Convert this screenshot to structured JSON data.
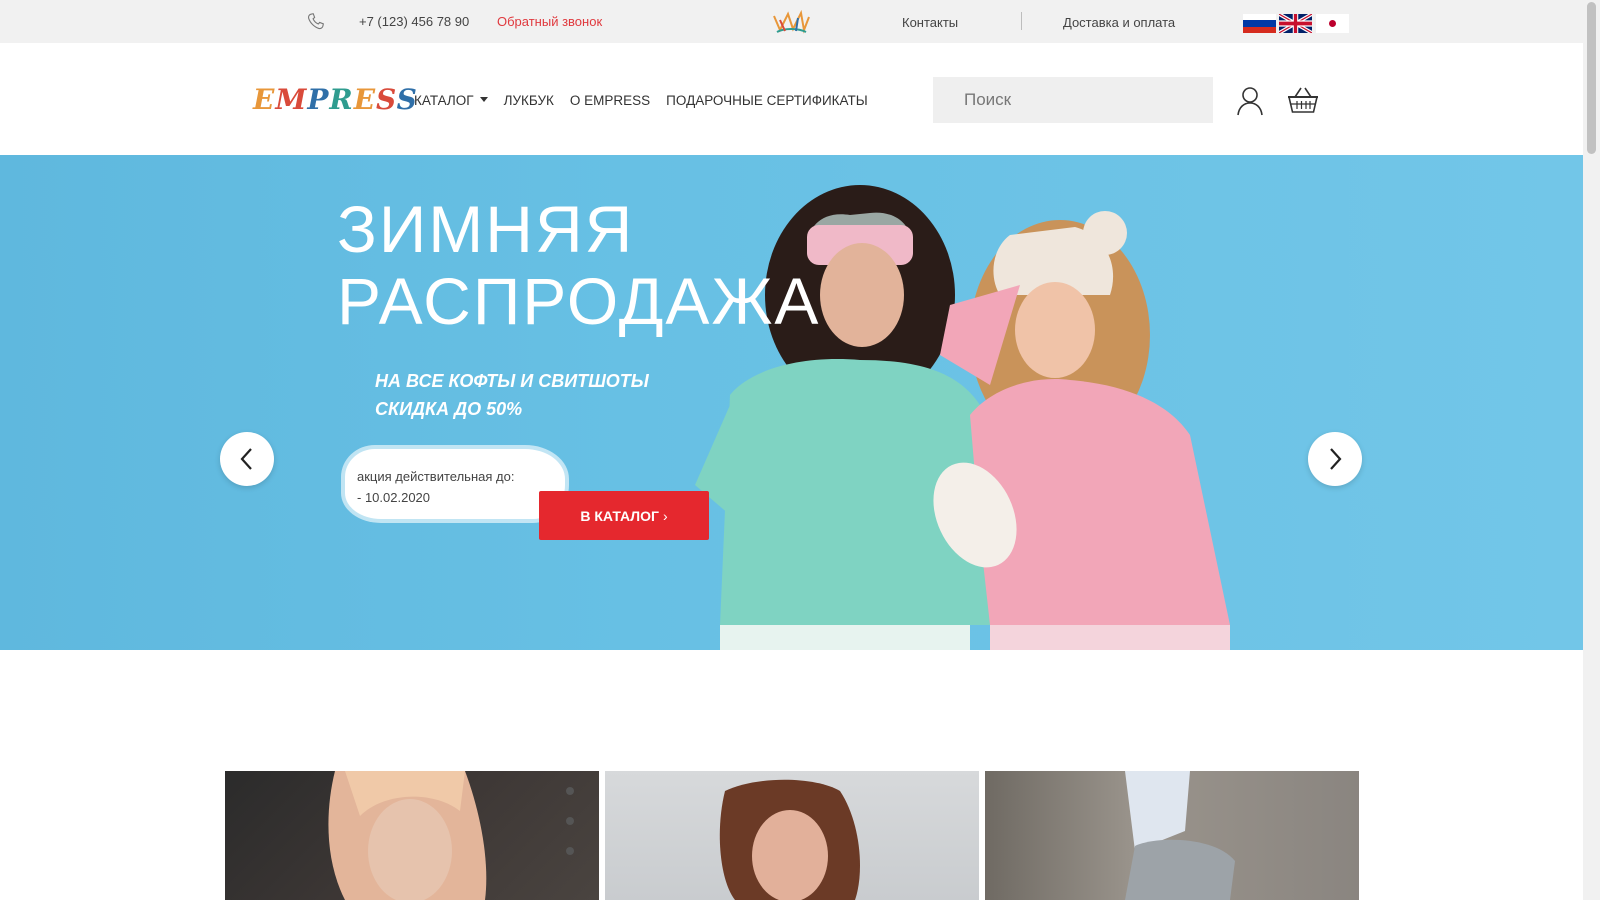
{
  "topbar": {
    "phone": "+7 (123) 456 78 90",
    "callback": "Обратный звонок",
    "contacts": "Контакты",
    "delivery": "Доставка и оплата",
    "languages": [
      "ru",
      "en",
      "jp"
    ]
  },
  "header": {
    "logo": "EMPRESS",
    "nav": {
      "catalog": "КАТАЛОГ",
      "lookbook": "ЛУКБУК",
      "about": "О EMPRESS",
      "certificates": "ПОДАРОЧНЫЕ СЕРТИФИКАТЫ"
    },
    "search_placeholder": "Поиск",
    "icons": [
      "phone-icon",
      "crown-icon",
      "user-icon",
      "basket-icon"
    ]
  },
  "hero": {
    "title_line1": "ЗИМНЯЯ",
    "title_line2": "РАСПРОДАЖА",
    "sub_line1": "НА ВСЕ КОФТЫ И СВИТШОТЫ",
    "sub_line2": "СКИДКА ДО 50%",
    "promo_line1": "акция действительная до:",
    "promo_line2": "- 10.02.2020",
    "button": "В КАТАЛОГ",
    "button_icon": "chevron-right-icon",
    "prev_icon": "chevron-left-icon",
    "next_icon": "chevron-right-icon"
  },
  "colors": {
    "accent": "#e5282e",
    "hero_bg": "#67c0e4",
    "topbar_bg": "#f1f1f1"
  }
}
